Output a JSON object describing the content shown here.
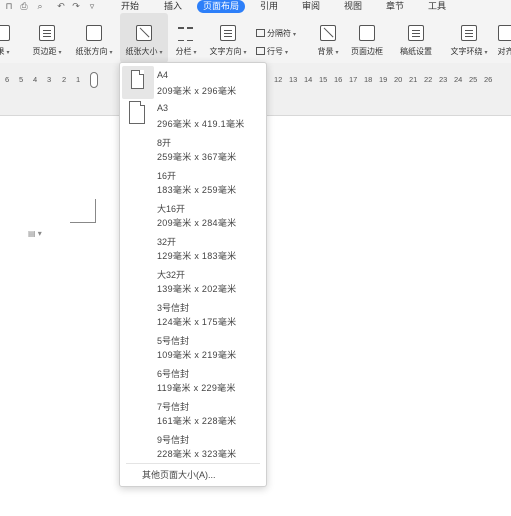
{
  "quick_access": [
    {
      "name": "app-menu-icon",
      "glyph": "⊓"
    },
    {
      "name": "print-icon",
      "glyph": "⎙"
    },
    {
      "name": "print-preview-icon",
      "glyph": "⌕"
    },
    {
      "name": "undo-icon",
      "glyph": "↶"
    },
    {
      "name": "redo-icon",
      "glyph": "↷"
    },
    {
      "name": "customize-icon",
      "glyph": "▿"
    }
  ],
  "menu_tabs": [
    "开始",
    "插入",
    "页面布局",
    "引用",
    "审阅",
    "视图",
    "章节",
    "工具"
  ],
  "active_tab": "页面布局",
  "ribbon": {
    "theme": "果",
    "margins": "页边距",
    "orientation": "纸张方向",
    "paper_size": "纸张大小",
    "columns": "分栏",
    "text_direction": "文字方向",
    "separator": "分隔符",
    "line_number": "行号",
    "background": "背景",
    "page_border": "页面边框",
    "paper_setting": "稿纸设置",
    "text_wrap": "文字环绕",
    "align": "对齐"
  },
  "ruler_numbers": [
    "6",
    "5",
    "4",
    "3",
    "2",
    "1",
    "12",
    "13",
    "14",
    "15",
    "16",
    "17",
    "18",
    "19",
    "20",
    "21",
    "22",
    "23",
    "24",
    "25",
    "26"
  ],
  "paper_sizes": [
    {
      "name": "A4",
      "dims": "209毫米 x 296毫米"
    },
    {
      "name": "A3",
      "dims": "296毫米 x 419.1毫米"
    },
    {
      "name": "8开",
      "dims": "259毫米 x 367毫米"
    },
    {
      "name": "16开",
      "dims": "183毫米 x 259毫米"
    },
    {
      "name": "大16开",
      "dims": "209毫米 x 284毫米"
    },
    {
      "name": "32开",
      "dims": "129毫米 x 183毫米"
    },
    {
      "name": "大32开",
      "dims": "139毫米 x 202毫米"
    },
    {
      "name": "3号信封",
      "dims": "124毫米 x 175毫米"
    },
    {
      "name": "5号信封",
      "dims": "109毫米 x 219毫米"
    },
    {
      "name": "6号信封",
      "dims": "119毫米 x 229毫米"
    },
    {
      "name": "7号信封",
      "dims": "161毫米 x 228毫米"
    },
    {
      "name": "9号信封",
      "dims": "228毫米 x 323毫米"
    }
  ],
  "selected_paper": "A4",
  "more_sizes": "其他页面大小(A)...",
  "accent_color": "#2d7ff9"
}
